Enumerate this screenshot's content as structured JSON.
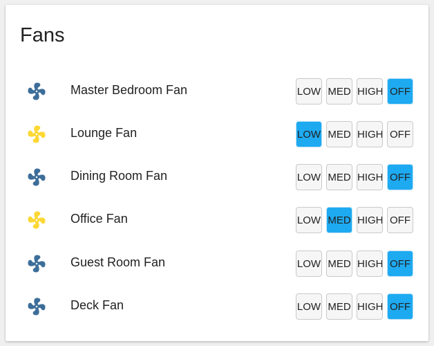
{
  "card": {
    "title": "Fans"
  },
  "colors": {
    "fan_off": "#3d6e9a",
    "fan_on": "#fdd835",
    "button_active": "#1eaaf1",
    "button_idle": "#f6f6f6"
  },
  "speed_labels": {
    "low": "LOW",
    "med": "MED",
    "high": "HIGH",
    "off": "OFF"
  },
  "fans": [
    {
      "name": "Master Bedroom Fan",
      "icon": "fan-icon",
      "state": "off",
      "active_speed": "off"
    },
    {
      "name": "Lounge Fan",
      "icon": "fan-icon",
      "state": "on",
      "active_speed": "low"
    },
    {
      "name": "Dining Room Fan",
      "icon": "fan-icon",
      "state": "off",
      "active_speed": "off"
    },
    {
      "name": "Office Fan",
      "icon": "fan-icon",
      "state": "on",
      "active_speed": "med"
    },
    {
      "name": "Guest Room Fan",
      "icon": "fan-icon",
      "state": "off",
      "active_speed": "off"
    },
    {
      "name": "Deck Fan",
      "icon": "fan-icon",
      "state": "off",
      "active_speed": "off"
    }
  ]
}
